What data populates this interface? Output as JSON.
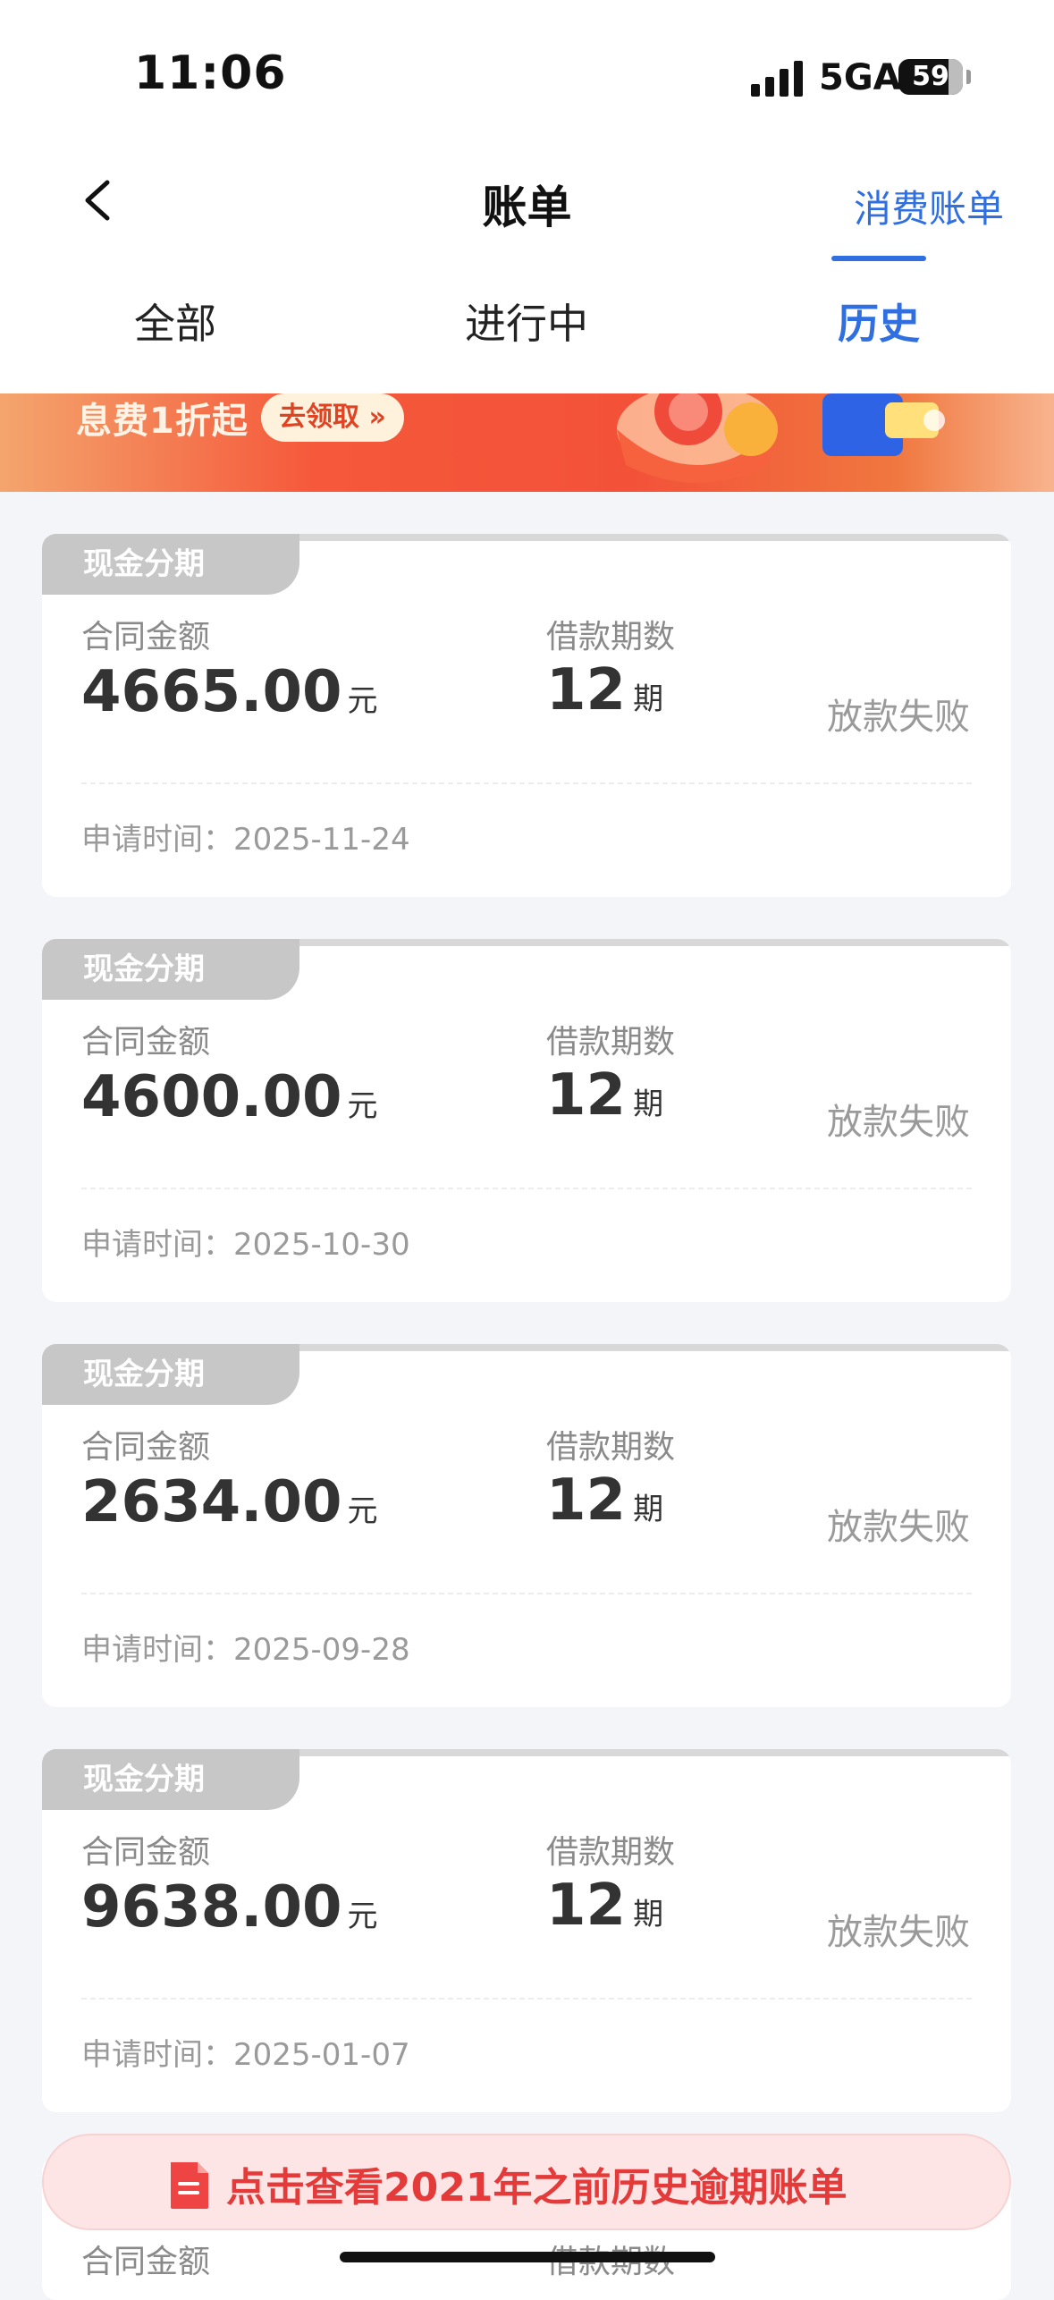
{
  "status_bar": {
    "time": "11:06",
    "network": "5GA",
    "battery": "59"
  },
  "header": {
    "title": "账单",
    "right_link": "消费账单"
  },
  "tabs": [
    {
      "label": "全部",
      "active": false
    },
    {
      "label": "进行中",
      "active": false
    },
    {
      "label": "历史",
      "active": true
    }
  ],
  "banner": {
    "text": "息费1折起",
    "button": "去领取 »"
  },
  "labels": {
    "amount": "合同金额",
    "periods": "借款期数",
    "date_prefix": "申请时间：",
    "unit_yuan": "元",
    "unit_period": "期"
  },
  "bills": [
    {
      "tag": "现金分期",
      "amount": "4665.00",
      "periods": "12",
      "status": "放款失败",
      "date": "2025-11-24"
    },
    {
      "tag": "现金分期",
      "amount": "4600.00",
      "periods": "12",
      "status": "放款失败",
      "date": "2025-10-30"
    },
    {
      "tag": "现金分期",
      "amount": "2634.00",
      "periods": "12",
      "status": "放款失败",
      "date": "2025-09-28"
    },
    {
      "tag": "现金分期",
      "amount": "9638.00",
      "periods": "12",
      "status": "放款失败",
      "date": "2025-01-07"
    }
  ],
  "overdue_link": {
    "text": "点击查看2021年之前历史逾期账单"
  },
  "colors": {
    "accent": "#2f6fe0",
    "danger": "#e43a3a",
    "tag_bg": "#c7c7c7"
  }
}
